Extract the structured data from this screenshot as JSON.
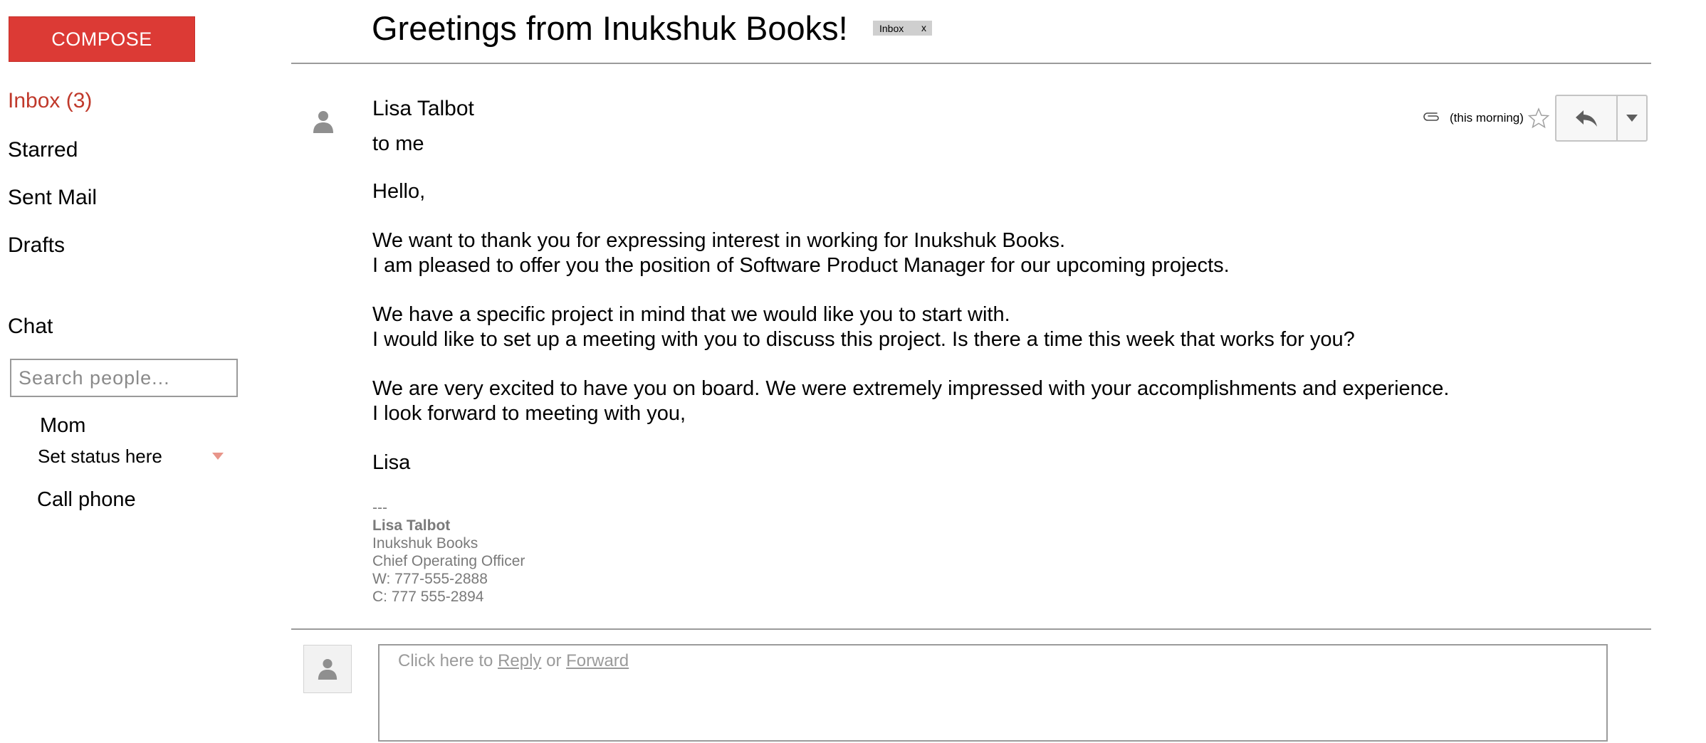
{
  "sidebar": {
    "compose_label": "COMPOSE",
    "nav": [
      {
        "label": "Inbox (3)"
      },
      {
        "label": "Starred"
      },
      {
        "label": "Sent Mail"
      },
      {
        "label": "Drafts"
      }
    ],
    "chat_heading": "Chat",
    "search_placeholder": "Search people...",
    "contact_name": "Mom",
    "status_text": "Set status here",
    "call_phone": "Call phone"
  },
  "email": {
    "subject": "Greetings from Inukshuk Books!",
    "label_chip": "Inbox",
    "label_chip_close": "x",
    "sender": "Lisa Talbot",
    "recipient": "to me",
    "timestamp": "(this morning)",
    "body": [
      "Hello,",
      "We want to thank you for expressing interest in working for Inukshuk Books.",
      "I am pleased to offer you the position of Software Product Manager for our upcoming projects.",
      "We have a specific project in mind that we would like you to start with.",
      "I would like to set up a meeting with you to discuss this project. Is there a time this week that works for you?",
      "We are very excited to have you on board. We were extremely impressed with your accomplishments and experience.",
      "I look forward to meeting with you,",
      "Lisa"
    ],
    "signature": {
      "separator": "---",
      "name": "Lisa Talbot",
      "company": "Inukshuk Books",
      "title": "Chief Operating Officer",
      "work_phone": "W: 777-555-2888",
      "cell_phone": "C: 777 555-2894"
    }
  },
  "reply_box": {
    "prompt_start": "Click here to ",
    "reply_link": "Reply",
    "prompt_or": " or ",
    "forward_link": "Forward"
  },
  "colors": {
    "compose_bg": "#dc3a35",
    "inbox_active": "#c0392b",
    "status_caret": "#e8958a",
    "icon_gray": "#8f8f8f"
  },
  "icons": {
    "avatar": "person-icon",
    "attachment": "paperclip-icon",
    "star": "star-outline-icon",
    "reply": "reply-arrow-icon",
    "more": "caret-down-icon"
  }
}
